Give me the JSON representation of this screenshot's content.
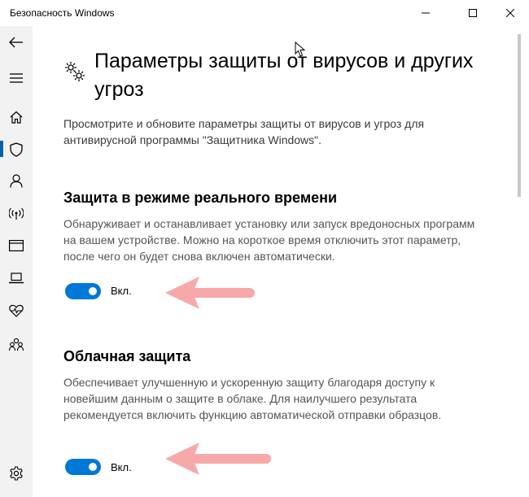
{
  "window": {
    "title": "Безопасность Windows"
  },
  "sidebar": {
    "items": [
      {
        "icon": "back-arrow-icon"
      },
      {
        "icon": "hamburger-menu-icon"
      },
      {
        "icon": "home-icon"
      },
      {
        "icon": "shield-icon",
        "active": true
      },
      {
        "icon": "account-icon"
      },
      {
        "icon": "network-icon"
      },
      {
        "icon": "app-browser-icon"
      },
      {
        "icon": "device-laptop-icon"
      },
      {
        "icon": "heart-icon"
      },
      {
        "icon": "family-icon"
      },
      {
        "icon": "settings-gear-icon"
      }
    ],
    "accent_color": "#0063b1"
  },
  "main": {
    "title": "Параметры защиты от вирусов и других угроз",
    "intro": "Просмотрите и обновите параметры защиты от вирусов и угроз для антивирусной программы \"Защитника Windows\".",
    "sections": [
      {
        "title": "Защита в режиме реального времени",
        "description": "Обнаруживает и останавливает установку или запуск вредоносных программ на вашем устройстве. Можно на короткое время отключить этот параметр, после чего он будет снова включен автоматически.",
        "toggle_state": true,
        "toggle_label": "Вкл."
      },
      {
        "title": "Облачная защита",
        "description": "Обеспечивает улучшенную и ускоренную защиту благодаря доступу к новейшим данным о защите в облаке. Для наилучшего результата рекомендуется включить функцию автоматической отправки образцов.",
        "toggle_state": true,
        "toggle_label": "Вкл."
      }
    ]
  },
  "colors": {
    "toggle_on": "#0078d7",
    "annotation_arrow": "#f7a9a9"
  }
}
